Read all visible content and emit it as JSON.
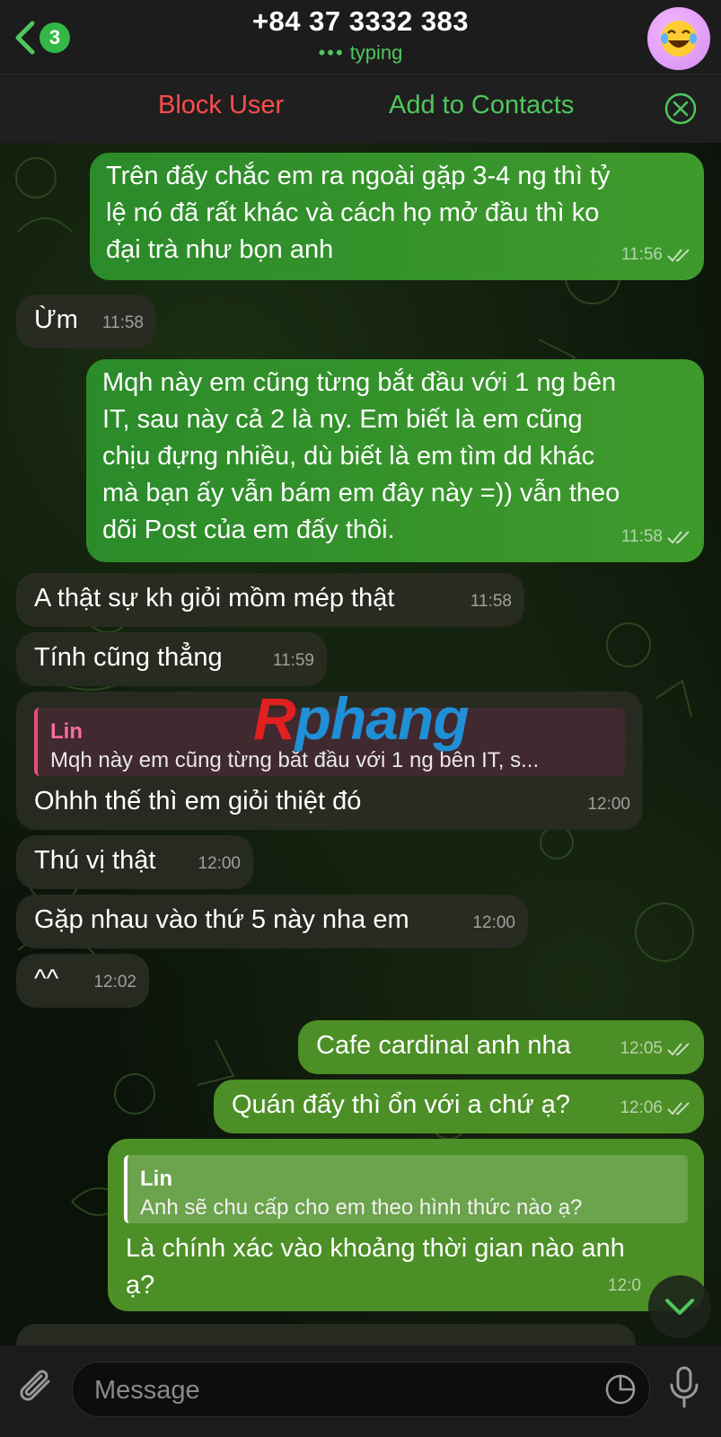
{
  "header": {
    "back_count": "3",
    "title": "+84 37 3332 383",
    "status_dots": "•••",
    "status": "typing"
  },
  "actionbar": {
    "block": "Block User",
    "add_contact": "Add to Contacts"
  },
  "messages": [
    {
      "dir": "out",
      "text_lines": [
        "Trên đấy chắc em ra ngoài gặp 3-4 ng thì tỷ",
        "lệ nó đã rất khác và cách họ mở đầu thì ko",
        "đại trà như bọn anh"
      ],
      "time": "11:56"
    },
    {
      "dir": "in",
      "text": "Ừm",
      "time": "11:58"
    },
    {
      "dir": "out",
      "text_lines": [
        "Mqh này em cũng từng bắt đầu với 1 ng bên",
        "IT, sau này cả 2 là ny. Em biết là em cũng",
        "chịu đựng nhiều, dù biết là em tìm dd khác",
        "mà bạn ấy vẫn bám em đây này =)) vẫn theo",
        "dõi Post của em đấy thôi."
      ],
      "time": "11:58"
    },
    {
      "dir": "in",
      "text": "A thật sự kh giỏi mồm mép thật",
      "time": "11:58"
    },
    {
      "dir": "in",
      "text": "Tính cũng thẳng",
      "time": "11:59"
    },
    {
      "dir": "in",
      "reply_name": "Lin",
      "reply_text": "Mqh này em cũng từng bắt đầu với 1 ng bên IT, s...",
      "text": "Ohhh thế thì em giỏi thiệt đó",
      "time": "12:00"
    },
    {
      "dir": "in",
      "text": "Thú vị thật",
      "time": "12:00"
    },
    {
      "dir": "in",
      "text": "Gặp nhau vào thứ 5 này nha em",
      "time": "12:00"
    },
    {
      "dir": "in",
      "text": "^^",
      "time": "12:02"
    },
    {
      "dir": "out",
      "text": "Cafe cardinal anh nha",
      "time": "12:05"
    },
    {
      "dir": "out",
      "text": "Quán đấy thì ổn với a chứ ạ?",
      "time": "12:06"
    },
    {
      "dir": "out",
      "reply_name": "Lin",
      "reply_text": "Anh sẽ chu cấp cho em theo hình thức nào ạ?",
      "text_lines": [
        "Là chính xác vào khoảng thời gian nào anh",
        "ạ?"
      ],
      "time": "12:0"
    }
  ],
  "watermark": {
    "part1": "R",
    "part2": "phang"
  },
  "input": {
    "placeholder": "Message"
  },
  "icons": {
    "back": "chevron-left-icon",
    "close": "close-circle-icon",
    "read_receipt": "double-check-icon",
    "attach": "paperclip-icon",
    "sticker": "sticker-icon",
    "mic": "microphone-icon",
    "scroll_down": "chevron-down-icon"
  },
  "colors": {
    "accent_green": "#4fc75c",
    "block_red": "#ff4d4d",
    "outgoing_bubble": "#3f9a2c",
    "incoming_bubble": "#282c22"
  }
}
